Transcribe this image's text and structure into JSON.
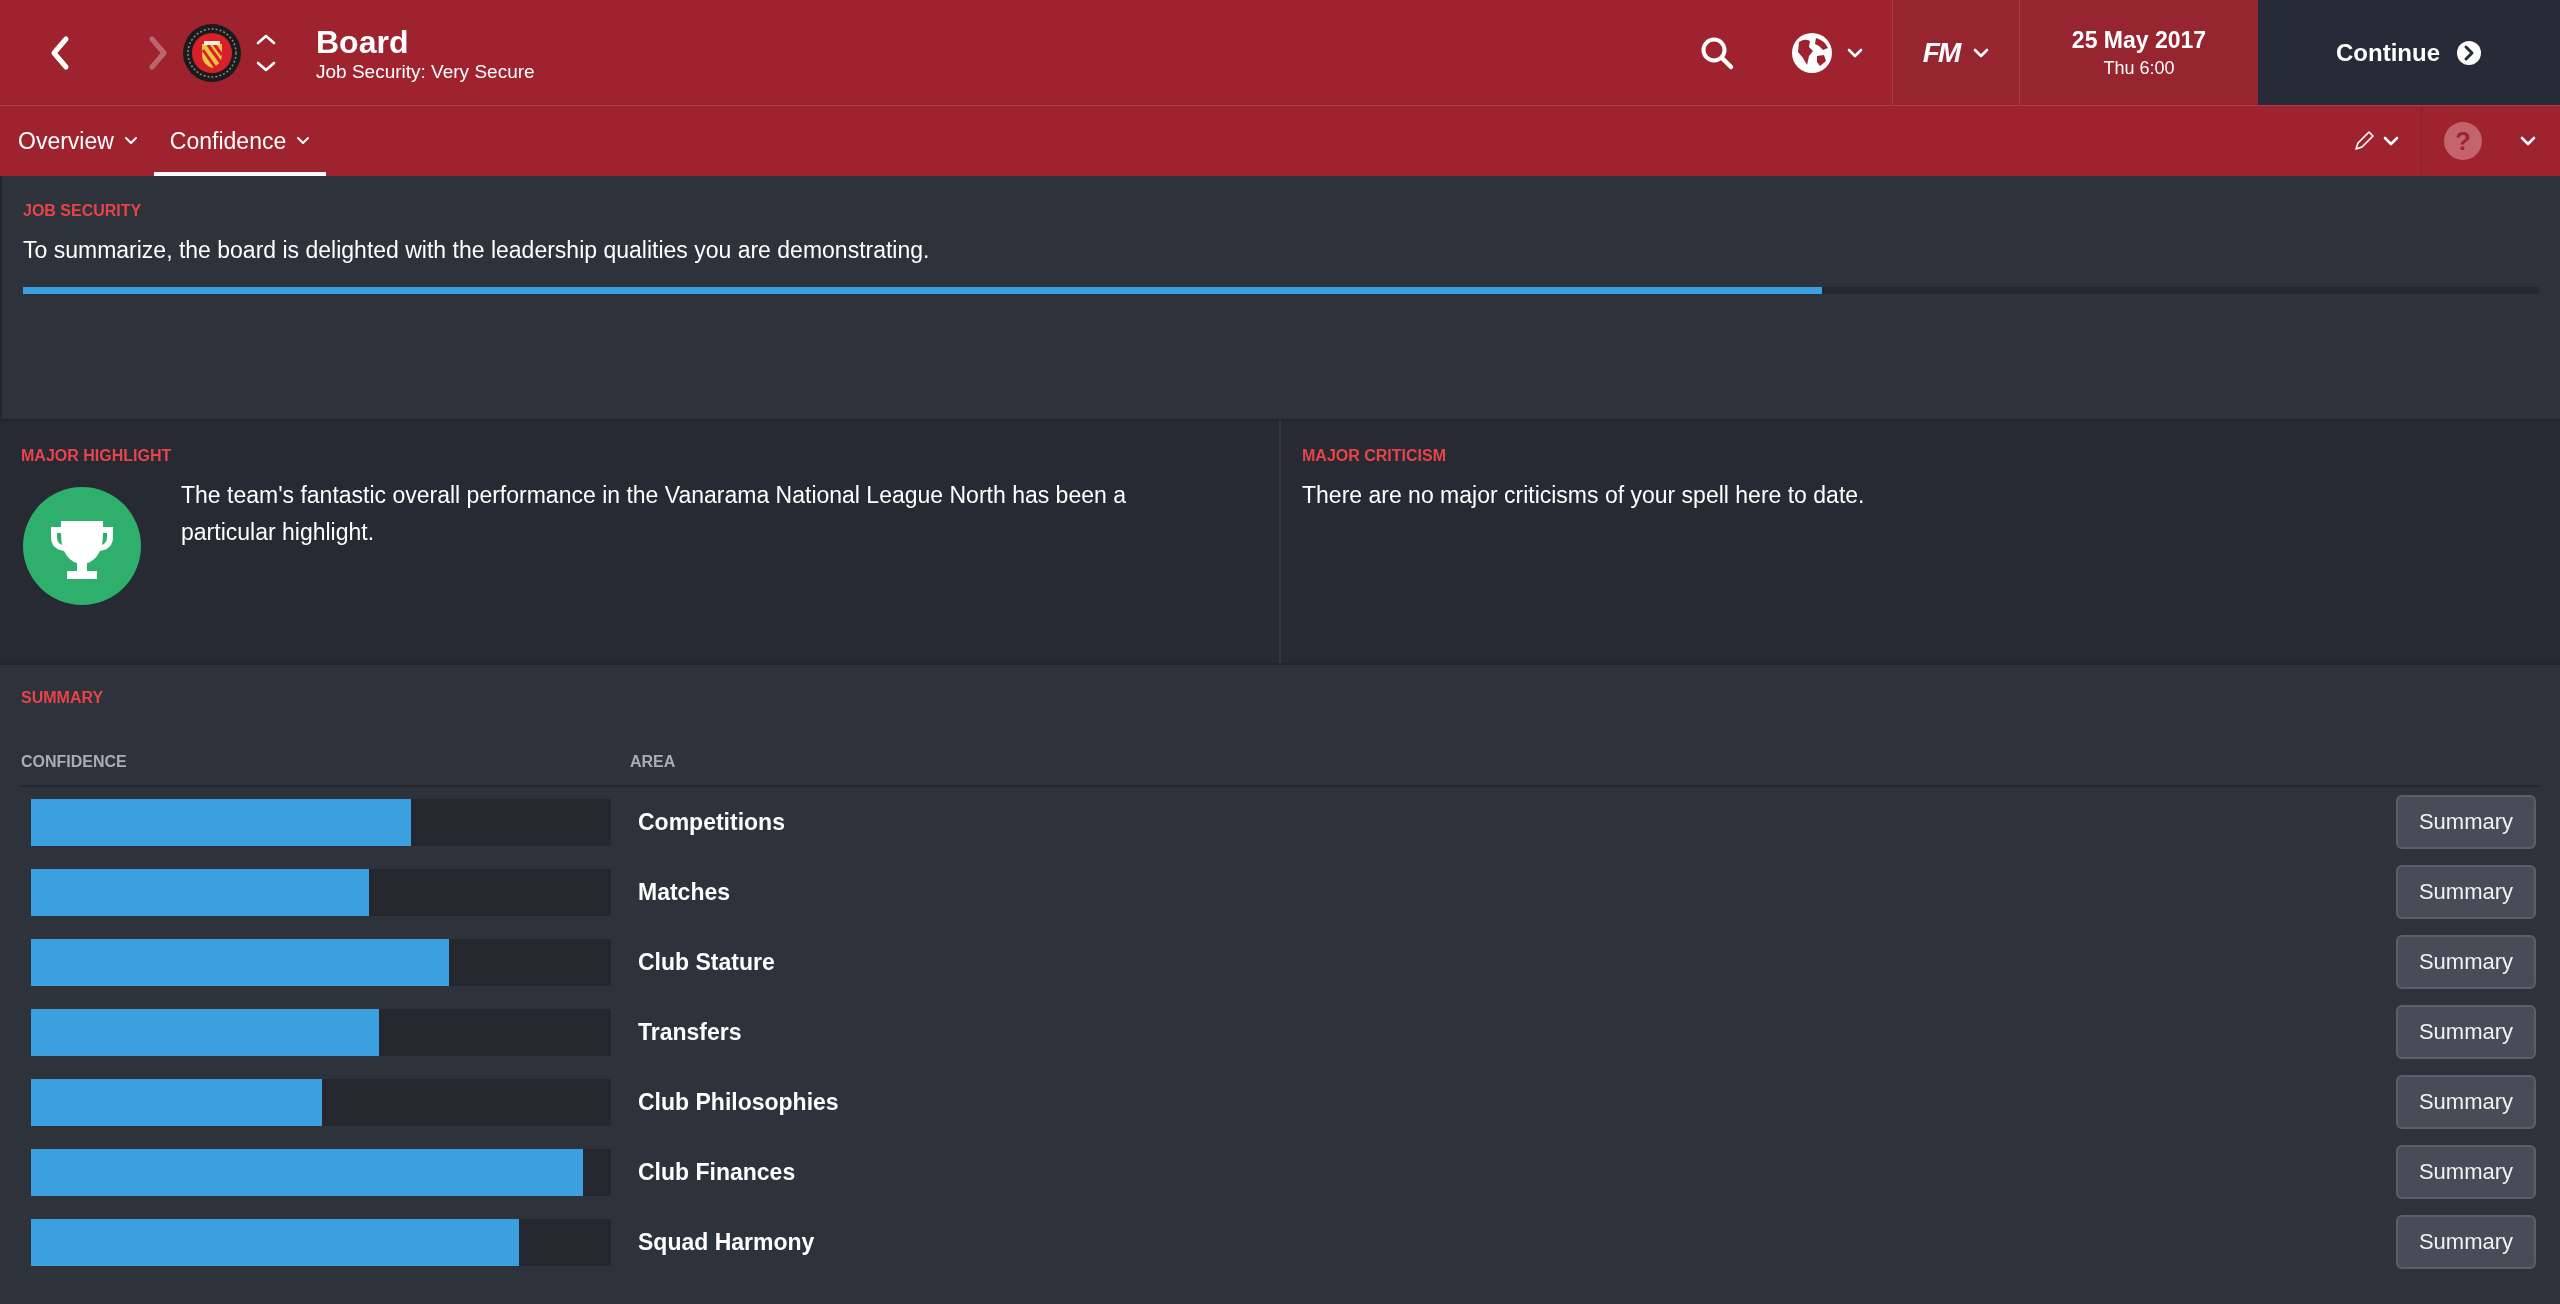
{
  "header": {
    "nav": [
      {
        "kind": "back",
        "disabled": false
      },
      {
        "kind": "forward",
        "disabled": true
      }
    ],
    "title": "Board",
    "subtitle": "Job Security: Very Secure",
    "logo": "FM",
    "date": "25 May 2017",
    "time": "Thu 6:00",
    "continue": "Continue"
  },
  "tabs": [
    {
      "label": "Overview",
      "selected": false
    },
    {
      "label": "Confidence",
      "selected": true
    }
  ],
  "help": "?",
  "job_security": {
    "heading": "JOB SECURITY",
    "text": "To summarize, the board is delighted with the leadership qualities you are demonstrating.",
    "level": 0.715
  },
  "highlight": {
    "heading": "MAJOR HIGHLIGHT",
    "text": "The team's fantastic overall performance in the Vanarama National League North has been a particular highlight."
  },
  "criticism": {
    "heading": "MAJOR CRITICISM",
    "text": "There are no major criticisms of your spell here to date."
  },
  "summary": {
    "heading": "SUMMARY",
    "columns": [
      "CONFIDENCE",
      "AREA"
    ],
    "rows": [
      {
        "area": "Competitions",
        "level": 0.656,
        "button": "Summary"
      },
      {
        "area": "Matches",
        "level": 0.583,
        "button": "Summary"
      },
      {
        "area": "Club Stature",
        "level": 0.721,
        "button": "Summary"
      },
      {
        "area": "Transfers",
        "level": 0.6,
        "button": "Summary"
      },
      {
        "area": "Club Philosophies",
        "level": 0.501,
        "button": "Summary"
      },
      {
        "area": "Club Finances",
        "level": 0.952,
        "button": "Summary"
      },
      {
        "area": "Squad Harmony",
        "level": 0.842,
        "button": "Summary"
      }
    ]
  }
}
